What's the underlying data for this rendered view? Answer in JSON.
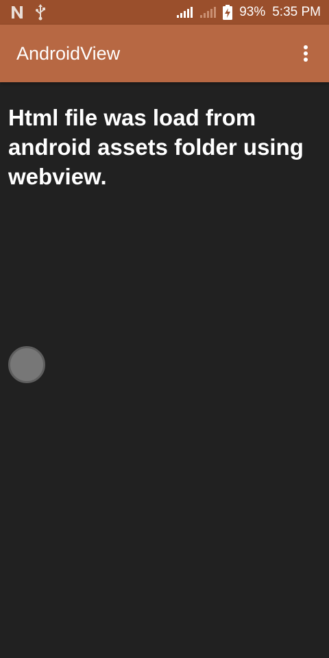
{
  "status_bar": {
    "left_icons": [
      "n-notification-icon",
      "usb-icon"
    ],
    "battery_percent": "93%",
    "time": "5:35 PM"
  },
  "app_bar": {
    "title": "AndroidView",
    "menu_icon": "more-vertical-icon"
  },
  "content": {
    "heading": "Html file was load from android assets folder using webview."
  },
  "colors": {
    "status_bar": "#9A4F2C",
    "app_bar": "#B76843",
    "background": "#212121",
    "circle": "#777777"
  }
}
